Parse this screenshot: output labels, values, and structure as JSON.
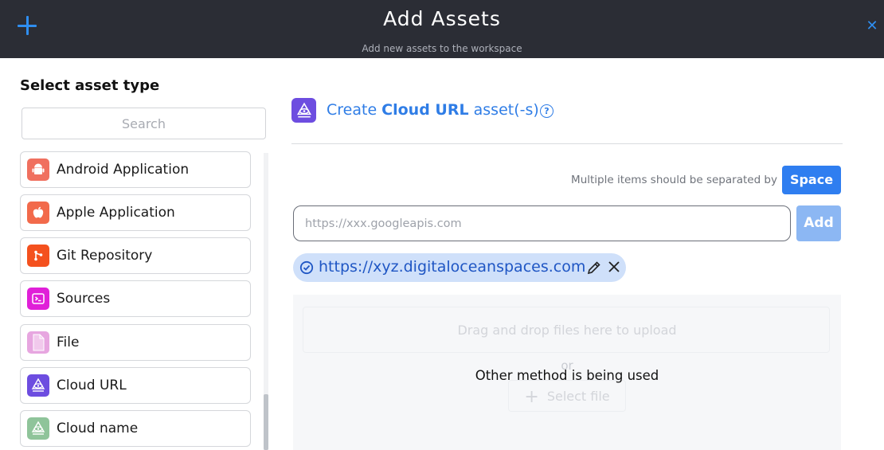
{
  "header": {
    "title": "Add Assets",
    "subtitle": "Add new assets to the workspace",
    "accent_color": "#2f8ef0",
    "add_icon": "plus-icon",
    "close_icon": "close-icon"
  },
  "sidebar": {
    "title": "Select asset type",
    "search_placeholder": "Search",
    "items": [
      {
        "label": "Android Application",
        "icon": "android-icon",
        "color": "#f0705f"
      },
      {
        "label": "Apple Application",
        "icon": "apple-icon",
        "color": "#f26a4b"
      },
      {
        "label": "Git Repository",
        "icon": "git-icon",
        "color": "#f4511e"
      },
      {
        "label": "Sources",
        "icon": "terminal-icon",
        "color": "#e020d8"
      },
      {
        "label": "File",
        "icon": "file-icon",
        "color": "#e7a6e0"
      },
      {
        "label": "Cloud URL",
        "icon": "cloud-eye-icon",
        "color": "#6d4de0"
      },
      {
        "label": "Cloud name",
        "icon": "cloud-name-icon",
        "color": "#8fc49a"
      }
    ]
  },
  "main": {
    "heading_prefix": "Create ",
    "heading_bold": "Cloud URL",
    "heading_suffix": " asset(-s)",
    "help_icon": "help-icon",
    "separator_note": "Multiple items should be separated by",
    "separator_key": "Space",
    "url_placeholder": "https://xxx.googleapis.com",
    "url_value": "",
    "add_label": "Add",
    "chips": [
      {
        "value": "https://xyz.digitaloceanspaces.com"
      }
    ],
    "dropzone": {
      "text": "Drag and drop files here to upload",
      "or": "or",
      "select_label": "Select file",
      "overlay": "Other method is being used"
    }
  }
}
